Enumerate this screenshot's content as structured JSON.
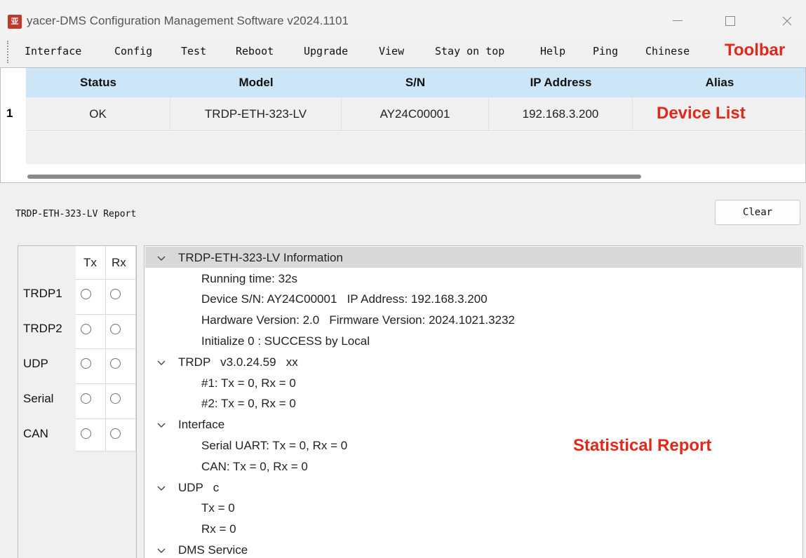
{
  "window": {
    "icon_text": "亚",
    "title": "yacer-DMS Configuration Management Software v2024.1101"
  },
  "menu": {
    "items": [
      "Interface",
      "Config",
      "Test",
      "Reboot",
      "Upgrade",
      "View",
      "Stay on top",
      "Help",
      "Ping",
      "Chinese"
    ]
  },
  "annotations": {
    "toolbar": "Toolbar",
    "device_list": "Device List",
    "statistical_report": "Statistical Report"
  },
  "device_list": {
    "columns": [
      "Status",
      "Model",
      "S/N",
      "IP Address",
      "Alias"
    ],
    "rows": [
      {
        "index": "1",
        "status": "OK",
        "model": "TRDP-ETH-323-LV",
        "sn": "AY24C00001",
        "ip": "192.168.3.200",
        "alias": ""
      }
    ]
  },
  "report": {
    "title": "TRDP-ETH-323-LV Report",
    "clear_label": "Clear"
  },
  "status_table": {
    "tx_label": "Tx",
    "rx_label": "Rx",
    "rows": [
      "TRDP1",
      "TRDP2",
      "UDP",
      "Serial",
      "CAN"
    ]
  },
  "tree": [
    "TRDP-ETH-323-LV Information",
    "Running time: 32s",
    "Device S/N: AY24C00001   IP Address: 192.168.3.200",
    "Hardware Version: 2.0   Firmware Version: 2024.1021.3232",
    "Initialize 0 : SUCCESS by Local",
    "TRDP   v3.0.24.59   xx",
    "#1: Tx = 0, Rx = 0",
    "#2: Tx = 0, Rx = 0",
    "Interface",
    "Serial UART: Tx = 0, Rx = 0",
    "CAN: Tx = 0, Rx = 0",
    "UDP   c",
    "Tx = 0",
    "Rx = 0",
    "DMS Service"
  ],
  "colors": {
    "header_bg": "#cde6f7",
    "annotation_red": "#e0281b",
    "selected_row": "#d9d9d9"
  }
}
